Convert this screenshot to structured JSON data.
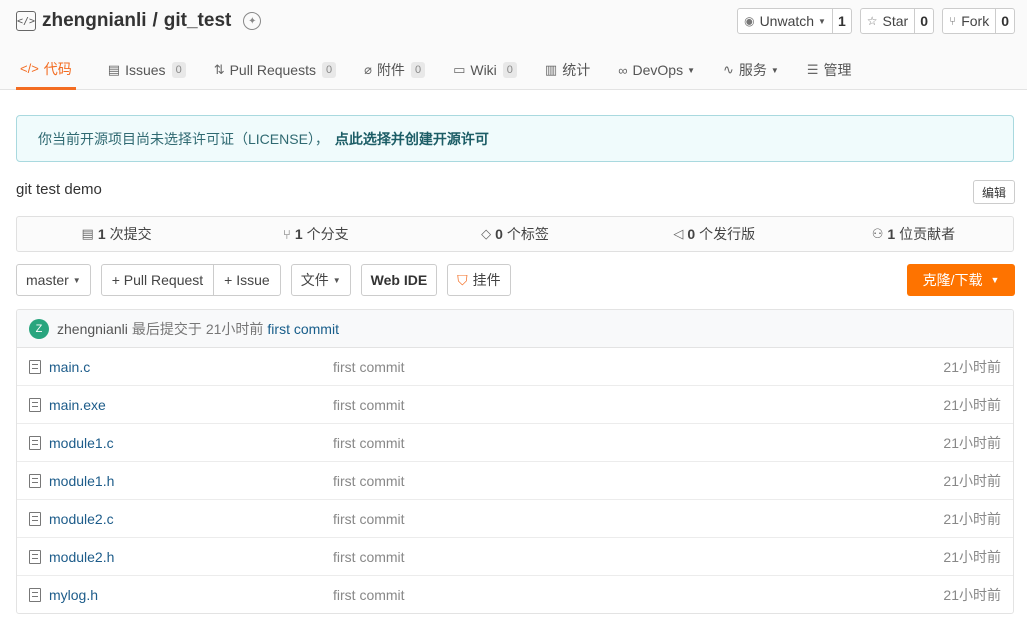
{
  "repo": {
    "owner": "zhengnianli",
    "separator": "/",
    "name": "git_test",
    "icon": "code-icon",
    "badge_icon": "recommend-badge-icon"
  },
  "actions": {
    "watch_label": "Unwatch",
    "watch_count": "1",
    "star_label": "Star",
    "star_count": "0",
    "fork_label": "Fork",
    "fork_count": "0"
  },
  "tabs": [
    {
      "label": "代码",
      "icon": "code-icon",
      "active": true
    },
    {
      "label": "Issues",
      "count": "0",
      "icon": "issues-icon"
    },
    {
      "label": "Pull Requests",
      "count": "0",
      "icon": "pull-request-icon"
    },
    {
      "label": "附件",
      "count": "0",
      "icon": "attachment-icon"
    },
    {
      "label": "Wiki",
      "count": "0",
      "icon": "wiki-icon"
    },
    {
      "label": "统计",
      "icon": "stats-icon"
    },
    {
      "label": "DevOps",
      "icon": "devops-icon"
    },
    {
      "label": "服务",
      "icon": "service-icon"
    },
    {
      "label": "管理",
      "icon": "manage-icon"
    }
  ],
  "notice": {
    "text": "你当前开源项目尚未选择许可证（LICENSE），",
    "link": "点此选择并创建开源许可"
  },
  "description": "git test demo",
  "edit_label": "编辑",
  "stats": [
    {
      "count": "1",
      "label": "次提交",
      "icon": "commit-icon"
    },
    {
      "count": "1",
      "label": "个分支",
      "icon": "branch-icon"
    },
    {
      "count": "0",
      "label": "个标签",
      "icon": "tag-icon"
    },
    {
      "count": "0",
      "label": "个发行版",
      "icon": "release-icon"
    },
    {
      "count": "1",
      "label": "位贡献者",
      "icon": "contributors-icon"
    }
  ],
  "toolbar": {
    "branch": "master",
    "pull_request": "+ Pull Request",
    "issue": "+ Issue",
    "file": "文件",
    "web_ide": "Web IDE",
    "pendant": "挂件",
    "clone": "克隆/下载"
  },
  "last_commit": {
    "avatar_letter": "Z",
    "user": "zhengnianli",
    "prefix": "最后提交于",
    "time": "21小时前",
    "message": "first commit"
  },
  "files": [
    {
      "name": "main.c",
      "message": "first commit",
      "time": "21小时前"
    },
    {
      "name": "main.exe",
      "message": "first commit",
      "time": "21小时前"
    },
    {
      "name": "module1.c",
      "message": "first commit",
      "time": "21小时前"
    },
    {
      "name": "module1.h",
      "message": "first commit",
      "time": "21小时前"
    },
    {
      "name": "module2.c",
      "message": "first commit",
      "time": "21小时前"
    },
    {
      "name": "module2.h",
      "message": "first commit",
      "time": "21小时前"
    },
    {
      "name": "mylog.h",
      "message": "first commit",
      "time": "21小时前"
    }
  ],
  "colors": {
    "accent": "#f36c21",
    "clone_button": "#fe7300",
    "link": "#1d5c8a",
    "notice_bg": "#f0fbfc"
  }
}
